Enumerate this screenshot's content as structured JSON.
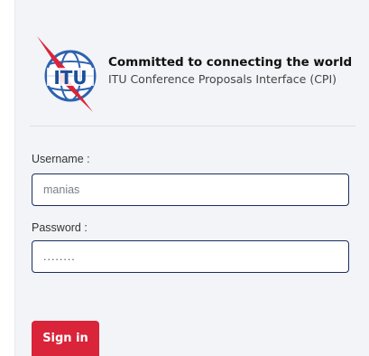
{
  "header": {
    "tagline": "Committed to connecting the world",
    "subtitle": "ITU Conference Proposals Interface (CPI)",
    "logo_text": "ITU"
  },
  "form": {
    "username_label": "Username :",
    "username_value": "manias",
    "password_label": "Password :",
    "password_value": "........",
    "signin_label": "Sign in"
  },
  "colors": {
    "brand_blue": "#1b4f9c",
    "button_red": "#d9243a",
    "panel_bg": "#f2f4f7"
  }
}
